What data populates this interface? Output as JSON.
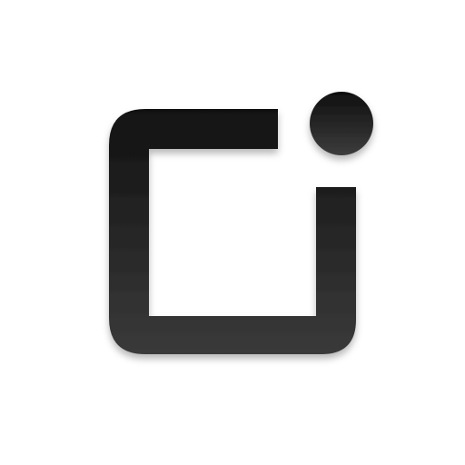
{
  "logo": {
    "icon": "notification-square-dot-icon",
    "colors": {
      "background": "#ffffff",
      "glyph_top": "#111111",
      "glyph_bottom": "#3a3a3a",
      "shadow": "#000000"
    }
  }
}
